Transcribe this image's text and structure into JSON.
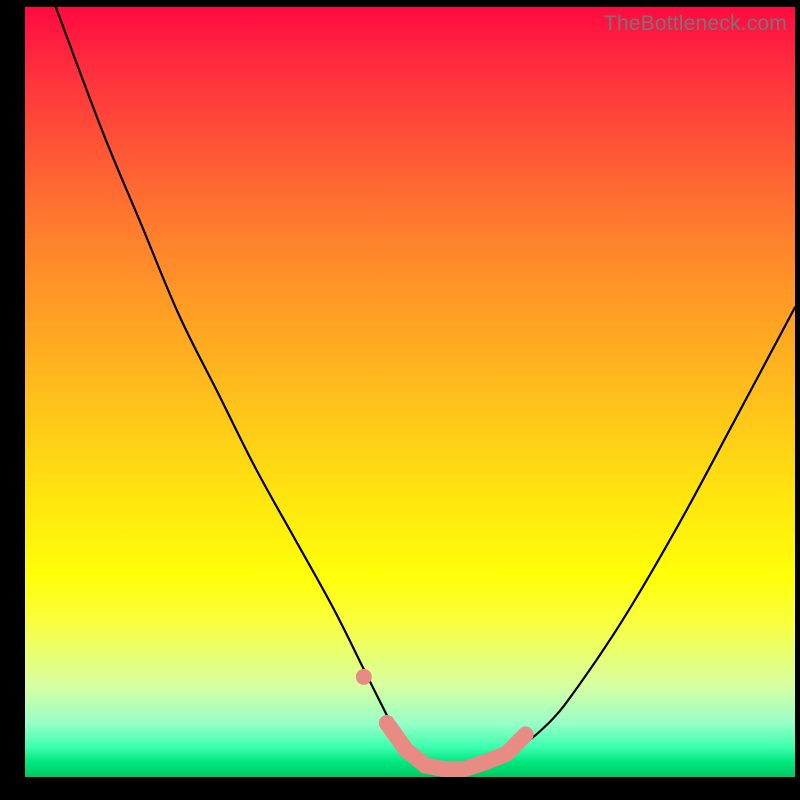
{
  "watermark": "TheBottleneck.com",
  "chart_data": {
    "type": "line",
    "title": "",
    "xlabel": "",
    "ylabel": "",
    "ylim": [
      0,
      100
    ],
    "xlim": [
      0,
      100
    ],
    "series": [
      {
        "name": "bottleneck-curve",
        "x": [
          4,
          10,
          15,
          20,
          25,
          30,
          35,
          40,
          44,
          47,
          49,
          51,
          53,
          56,
          60,
          63,
          68,
          72,
          78,
          85,
          92,
          100
        ],
        "values": [
          100,
          84,
          72,
          60,
          50,
          40,
          31,
          22,
          14,
          8,
          4,
          2,
          1,
          1,
          2,
          3,
          7,
          12,
          21,
          33,
          46,
          61
        ]
      }
    ],
    "markers": {
      "name": "highlight-dots",
      "x": [
        44,
        47,
        49.5,
        52,
        54.5,
        57,
        60,
        62.5,
        65
      ],
      "values": [
        13,
        7,
        3.5,
        1.5,
        1,
        1,
        2,
        3,
        5.5
      ]
    },
    "gradient_stops": [
      {
        "pos": 0,
        "color": "#ff0a40"
      },
      {
        "pos": 50,
        "color": "#ffc41a"
      },
      {
        "pos": 75,
        "color": "#ffff08"
      },
      {
        "pos": 100,
        "color": "#00c860"
      }
    ]
  }
}
